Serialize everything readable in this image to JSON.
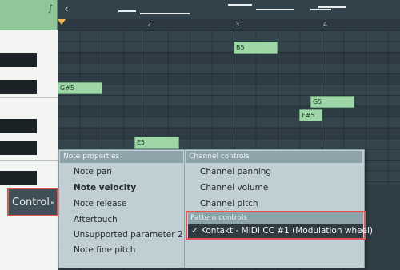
{
  "ruler": {
    "bars": [
      "2",
      "3",
      "4"
    ]
  },
  "notes": [
    {
      "label": "B5"
    },
    {
      "label": "G#5"
    },
    {
      "label": "G5"
    },
    {
      "label": "F#5"
    },
    {
      "label": "E5"
    }
  ],
  "control": {
    "label": "Control",
    "arrow": "▸"
  },
  "menu": {
    "left_header": "Note properties",
    "left_items": [
      "Note pan",
      "Note velocity",
      "Note release",
      "Aftertouch",
      "Unsupported parameter 2",
      "Note fine pitch"
    ],
    "right_header": "Channel controls",
    "right_items": [
      "Channel panning",
      "Channel volume",
      "Channel pitch"
    ],
    "pattern_header": "Pattern controls",
    "pattern_item": "Kontakt - MIDI CC #1 (Modulation wheel)",
    "pattern_check": "✓"
  },
  "icons": {
    "corner": "curve-icon",
    "back": "chevron-left-icon"
  }
}
